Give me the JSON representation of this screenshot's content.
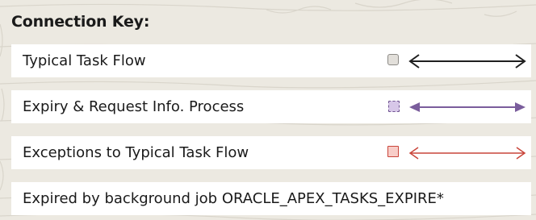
{
  "legend": {
    "title": "Connection Key:",
    "items": [
      {
        "label": "Typical Task Flow",
        "color": "#1f1f1f",
        "swatch_fill": "#e2dfda",
        "swatch_border": "#8c8a86",
        "arrow_style": "double-headed open"
      },
      {
        "label": "Expiry & Request Info. Process",
        "color": "#7a5d9c",
        "swatch_fill": "#d7c7e8",
        "swatch_border": "#6e5390",
        "arrow_style": "double-headed filled"
      },
      {
        "label": "Exceptions to Typical Task Flow",
        "color": "#c9453a",
        "swatch_fill": "#f8cdc8",
        "swatch_border": "#c9453a",
        "arrow_style": "double-headed open thin"
      },
      {
        "label": "Expired by background job ORACLE_APEX_TASKS_EXPIRE*"
      }
    ]
  }
}
